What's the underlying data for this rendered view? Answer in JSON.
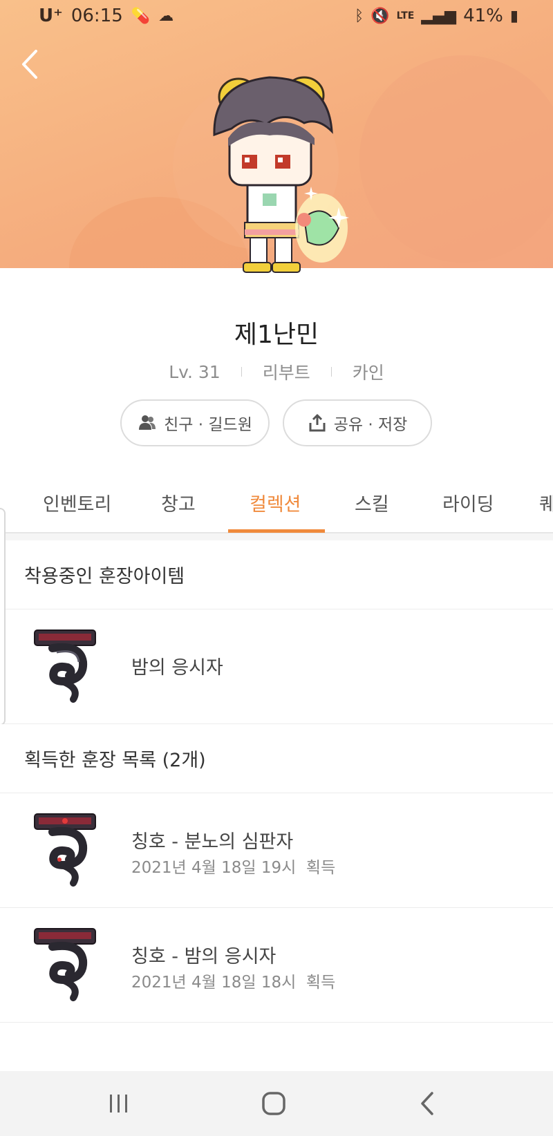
{
  "status_bar": {
    "carrier": "U⁺",
    "time": "06:15",
    "network": "LTE",
    "battery": "41%"
  },
  "profile": {
    "name": "제1난민",
    "level": "Lv. 31",
    "world": "리부트",
    "job": "카인",
    "friends_button": "친구 · 길드원",
    "share_button": "공유 · 저장"
  },
  "tabs": [
    {
      "label": "인벤토리"
    },
    {
      "label": "창고"
    },
    {
      "label": "컬렉션",
      "active": true
    },
    {
      "label": "스킬"
    },
    {
      "label": "라이딩"
    },
    {
      "label": "퀘"
    }
  ],
  "equipped_section": {
    "heading": "착용중인 훈장아이템",
    "item": "밤의 응시자"
  },
  "obtained_section": {
    "heading": "획득한 훈장 목록 (2개)",
    "items": [
      {
        "title": "칭호 - 분노의 심판자",
        "date": "2021년 4월 18일 19시",
        "status": "획득"
      },
      {
        "title": "칭호 - 밤의 응시자",
        "date": "2021년 4월 18일 18시",
        "status": "획득"
      }
    ]
  },
  "colors": {
    "accent": "#f08a3c",
    "banner": "#f5ad7e"
  }
}
